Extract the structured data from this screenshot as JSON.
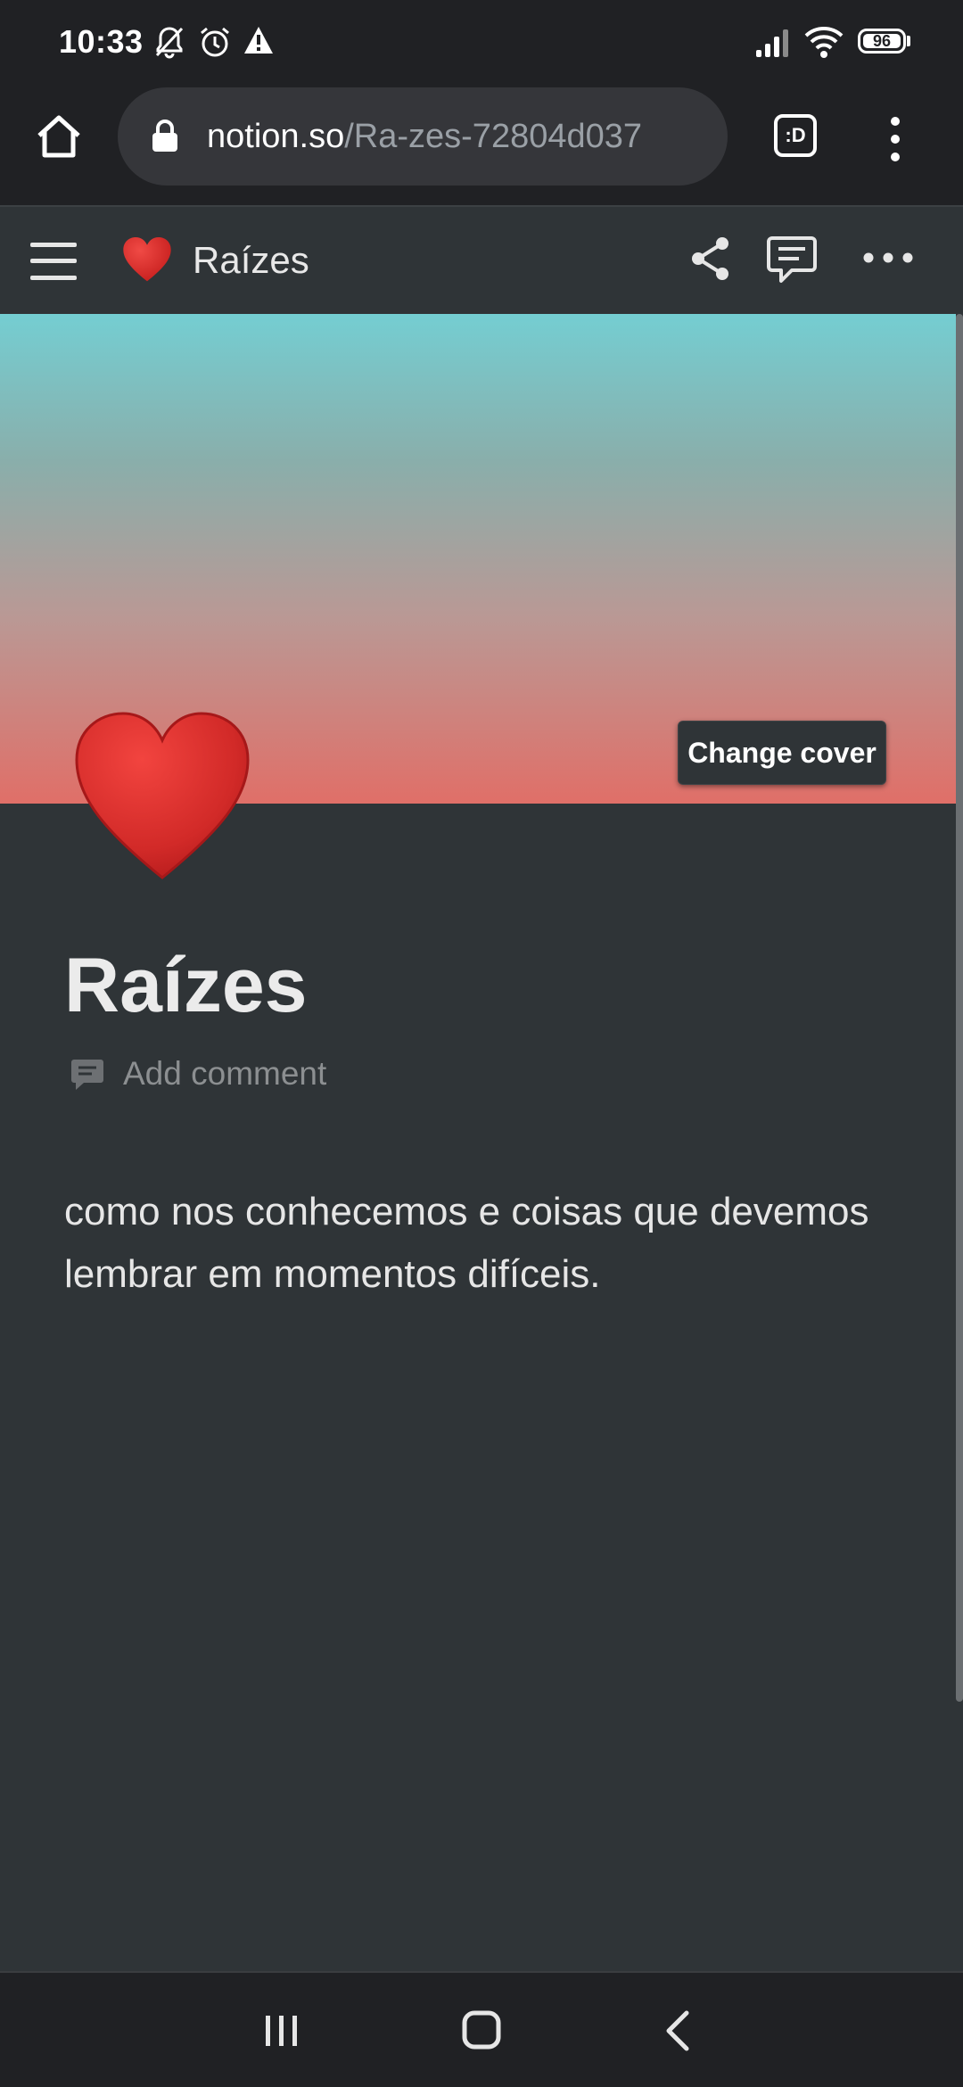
{
  "status_bar": {
    "time": "10:33",
    "battery": "96",
    "icons": [
      "mute-bell-icon",
      "alarm-icon",
      "warning-icon",
      "signal-icon",
      "wifi-icon",
      "battery-icon"
    ]
  },
  "browser": {
    "url_domain": "notion.so",
    "url_path": "/Ra-zes-72804d037",
    "tab_switcher_label": ":D"
  },
  "notion_topbar": {
    "page_emoji": "❤️",
    "page_title": "Raízes"
  },
  "cover": {
    "change_cover_label": "Change cover",
    "gradient_colors": [
      "#7fd6da",
      "#c8b3ae",
      "#e06f68"
    ]
  },
  "page": {
    "icon_emoji": "❤️",
    "title": "Raízes",
    "add_comment_label": "Add comment",
    "body_text": "como nos conhecemos e coisas que devemos lembrar em momentos difíceis."
  },
  "colors": {
    "chrome_bg": "#202124",
    "page_bg": "#2f3437",
    "heart_red": "#d8302c"
  }
}
